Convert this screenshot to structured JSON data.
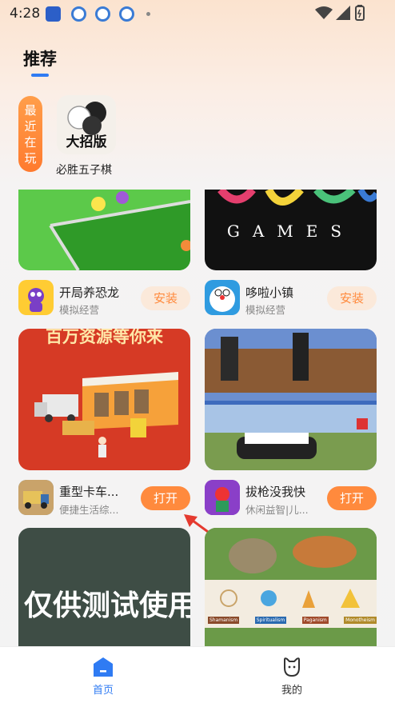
{
  "status_bar": {
    "time": "4:28"
  },
  "page": {
    "title": "推荐"
  },
  "recent": {
    "tag": [
      "最",
      "近",
      "在",
      "玩"
    ],
    "app_name": "必胜五子棋",
    "thumb_text": "大招版"
  },
  "apps": [
    {
      "name": "开局养恐龙",
      "category": "模拟经营",
      "button": "安装"
    },
    {
      "name": "哆啦小镇",
      "category": "模拟经营",
      "button": "安装",
      "banner_text": "GAMES"
    },
    {
      "name": "重型卡车...",
      "category": "便捷生活综...",
      "button": "打开",
      "banner_text": "百万资源等你来"
    },
    {
      "name": "拔枪没我快",
      "category": "休闲益智|儿...",
      "button": "打开"
    }
  ],
  "banners": {
    "test_card_text": "仅供测试使用",
    "religion_labels": [
      "Shamanism",
      "Spiritualism",
      "Paganism",
      "Monotheism"
    ]
  },
  "bottom_nav": {
    "items": [
      {
        "label": "首页",
        "active": true
      },
      {
        "label": "我的",
        "active": false
      }
    ]
  },
  "colors": {
    "accent": "#2f7bf3",
    "orange": "#ff8a3d"
  }
}
